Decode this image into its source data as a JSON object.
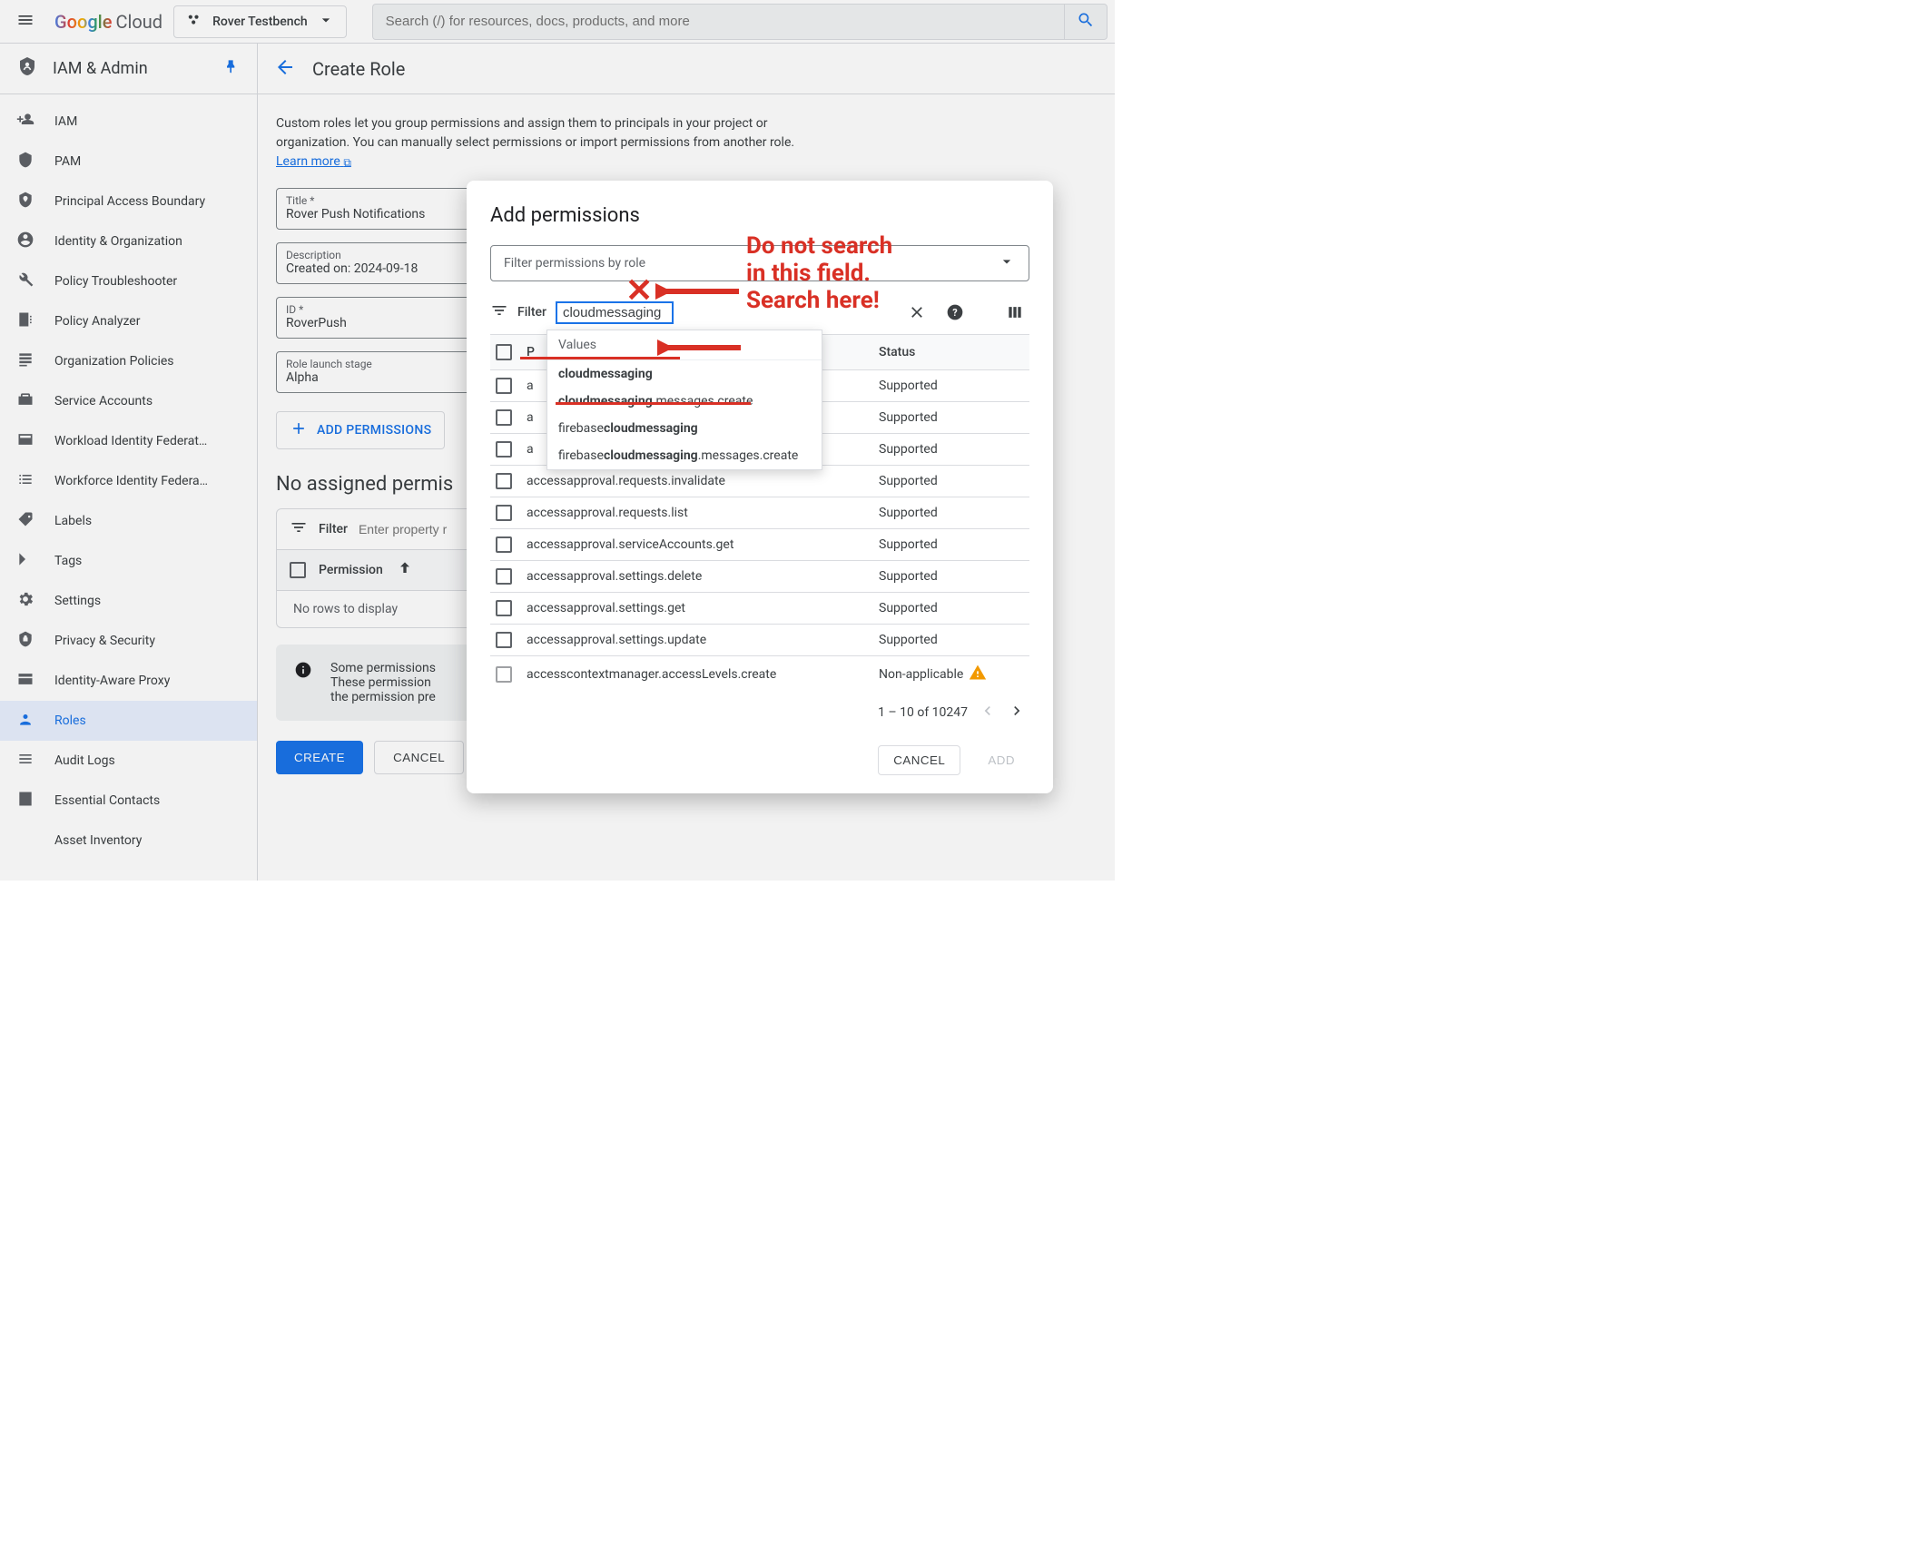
{
  "topbar": {
    "brand_google": "Google",
    "brand_cloud": "Cloud",
    "project": "Rover Testbench",
    "search_placeholder": "Search (/) for resources, docs, products, and more"
  },
  "sidebar": {
    "title": "IAM & Admin",
    "items": [
      {
        "label": "IAM",
        "icon": "person-add"
      },
      {
        "label": "PAM",
        "icon": "shield"
      },
      {
        "label": "Principal Access Boundary",
        "icon": "boundary"
      },
      {
        "label": "Identity & Organization",
        "icon": "account-circle"
      },
      {
        "label": "Policy Troubleshooter",
        "icon": "wrench"
      },
      {
        "label": "Policy Analyzer",
        "icon": "analyzer"
      },
      {
        "label": "Organization Policies",
        "icon": "list-doc"
      },
      {
        "label": "Service Accounts",
        "icon": "service-account"
      },
      {
        "label": "Workload Identity Federat…",
        "icon": "card"
      },
      {
        "label": "Workforce Identity Federa…",
        "icon": "list"
      },
      {
        "label": "Labels",
        "icon": "tag"
      },
      {
        "label": "Tags",
        "icon": "chevron-tag"
      },
      {
        "label": "Settings",
        "icon": "gear"
      },
      {
        "label": "Privacy & Security",
        "icon": "shield-lock"
      },
      {
        "label": "Identity-Aware Proxy",
        "icon": "iap"
      },
      {
        "label": "Roles",
        "icon": "roles",
        "active": true
      },
      {
        "label": "Audit Logs",
        "icon": "audit"
      },
      {
        "label": "Essential Contacts",
        "icon": "contacts"
      },
      {
        "label": "Asset Inventory",
        "icon": ""
      }
    ]
  },
  "page": {
    "title": "Create Role",
    "intro_pre": "Custom roles let you group permissions and assign them to principals in your project or organization. You can manually select permissions or import permissions from another role. ",
    "learn_more": "Learn more",
    "fields": {
      "title_label": "Title *",
      "title_value": "Rover Push Notifications",
      "desc_label": "Description",
      "desc_value": "Created on: 2024-09-18",
      "id_label": "ID *",
      "id_value": "RoverPush",
      "stage_label": "Role launch stage",
      "stage_value": "Alpha"
    },
    "add_permissions": "ADD PERMISSIONS",
    "no_assigned": "No assigned permis",
    "table": {
      "filter_label": "Filter",
      "filter_placeholder": "Enter property r",
      "col_permission": "Permission",
      "empty": "No rows to display"
    },
    "banner_line1": "Some permissions",
    "banner_line2": "These permission",
    "banner_line3": "the permission pre",
    "create": "CREATE",
    "cancel": "CANCEL"
  },
  "modal": {
    "title": "Add permissions",
    "role_filter_placeholder": "Filter permissions by role",
    "filter_label": "Filter",
    "filter_value": "cloudmessaging",
    "ac_header": "Values",
    "ac_options": [
      {
        "bold": "cloudmessaging",
        "rest": ""
      },
      {
        "bold": "cloudmessaging",
        "rest": ".messages.create",
        "underline": true
      },
      {
        "bold": "cloudmessaging",
        "rest": "",
        "prefix": "firebase"
      },
      {
        "bold": "cloudmessaging",
        "rest": ".messages.create",
        "prefix": "firebase"
      }
    ],
    "columns": {
      "perm": "P",
      "status": "Status"
    },
    "rows": [
      {
        "name": "a",
        "status": "Supported"
      },
      {
        "name": "a",
        "status": "Supported"
      },
      {
        "name": "a",
        "status": "Supported"
      },
      {
        "name": "accessapproval.requests.invalidate",
        "status": "Supported"
      },
      {
        "name": "accessapproval.requests.list",
        "status": "Supported"
      },
      {
        "name": "accessapproval.serviceAccounts.get",
        "status": "Supported"
      },
      {
        "name": "accessapproval.settings.delete",
        "status": "Supported"
      },
      {
        "name": "accessapproval.settings.get",
        "status": "Supported"
      },
      {
        "name": "accessapproval.settings.update",
        "status": "Supported"
      },
      {
        "name": "accesscontextmanager.accessLevels.create",
        "status": "Non-applicable",
        "warn": true
      }
    ],
    "pager": "1 – 10 of 10247",
    "cancel": "CANCEL",
    "add": "ADD"
  },
  "annotation": {
    "line1": "Do not search",
    "line2": "in this field.",
    "line3": "Search here!"
  }
}
